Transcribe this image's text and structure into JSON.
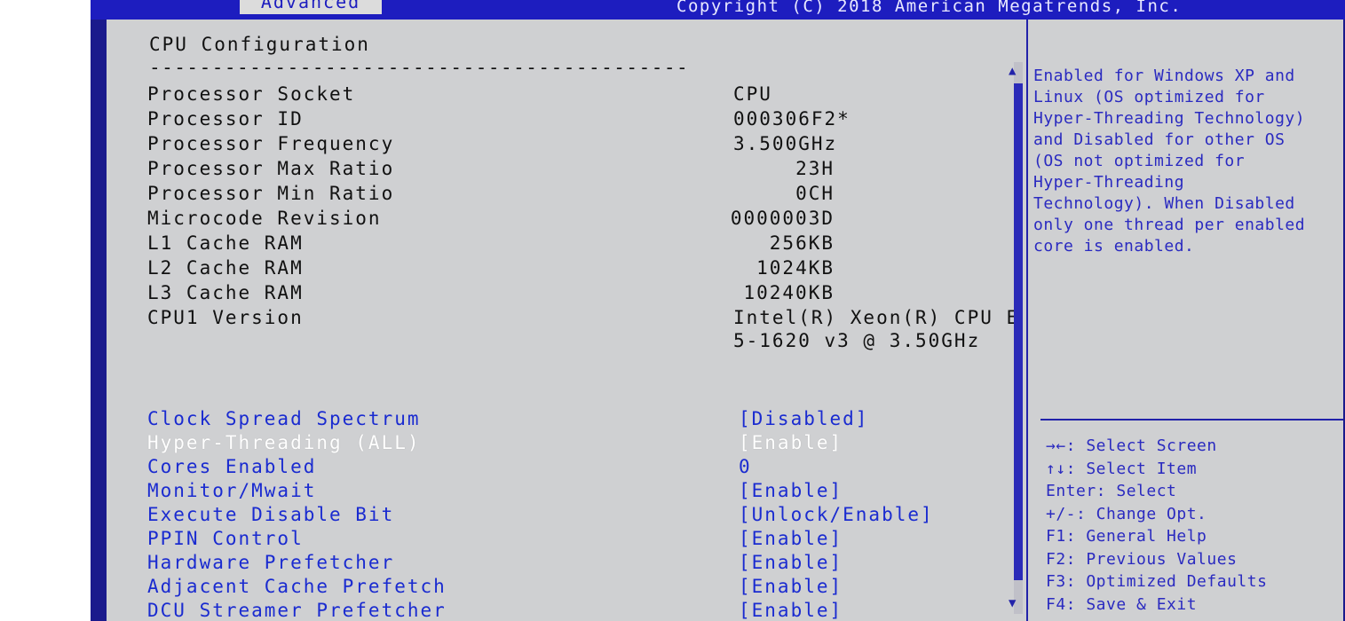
{
  "header": {
    "active_tab": "Advanced",
    "copyright": "Copyright (C) 2018 American Megatrends, Inc."
  },
  "page": {
    "title": "CPU Configuration",
    "separator": "-------------------------------------------"
  },
  "info_rows": [
    {
      "label": "Processor Socket",
      "value": "CPU"
    },
    {
      "label": "Processor ID",
      "value": "000306F2*"
    },
    {
      "label": "Processor Frequency",
      "value": "3.500GHz"
    },
    {
      "label": "Processor Max Ratio",
      "value": "23H"
    },
    {
      "label": "Processor Min Ratio",
      "value": "0CH"
    },
    {
      "label": "Microcode Revision",
      "value": "0000003D"
    },
    {
      "label": "L1 Cache RAM",
      "value": "256KB"
    },
    {
      "label": "L2 Cache RAM",
      "value": "1024KB"
    },
    {
      "label": "L3 Cache RAM",
      "value": "10240KB"
    },
    {
      "label": "CPU1 Version",
      "value": "Intel(R) Xeon(R) CPU E",
      "value2": "5-1620 v3 @ 3.50GHz"
    }
  ],
  "settings": [
    {
      "label": "Clock Spread Spectrum",
      "value": "[Disabled]"
    },
    {
      "label": "Hyper-Threading (ALL)",
      "value": "[Enable]",
      "selected": true
    },
    {
      "label": "Cores Enabled",
      "value": "0"
    },
    {
      "label": "Monitor/Mwait",
      "value": "[Enable]"
    },
    {
      "label": "Execute Disable Bit",
      "value": "[Unlock/Enable]"
    },
    {
      "label": "PPIN Control",
      "value": "[Enable]"
    },
    {
      "label": "Hardware Prefetcher",
      "value": "[Enable]"
    },
    {
      "label": "Adjacent Cache Prefetch",
      "value": "[Enable]"
    },
    {
      "label": "DCU Streamer Prefetcher",
      "value": "[Enable]"
    }
  ],
  "help": {
    "lines": [
      "Enabled for Windows XP and",
      "Linux (OS optimized for",
      "Hyper-Threading Technology)",
      "and Disabled for other OS",
      "(OS not optimized for",
      "Hyper-Threading",
      "Technology). When Disabled",
      "only one thread per enabled",
      "core is enabled."
    ]
  },
  "keys": [
    "→←: Select Screen",
    "↑↓: Select Item",
    "Enter: Select",
    "+/-: Change Opt.",
    "F1: General Help",
    "F2: Previous Values",
    "F3: Optimized Defaults",
    "F4: Save & Exit"
  ],
  "colors": {
    "frame": "#1a1a8c",
    "panel": "#cfd0d2",
    "setting_text": "#1a2bd0",
    "selected_text": "#ffffff"
  }
}
